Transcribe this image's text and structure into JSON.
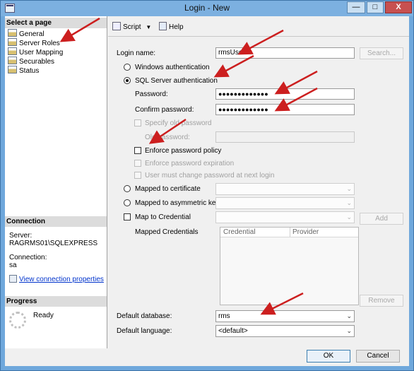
{
  "window": {
    "title": "Login - New",
    "min_label": "—",
    "max_label": "□",
    "close_label": "X"
  },
  "left_panel": {
    "select_page_heading": "Select a page",
    "pages": [
      {
        "label": "General"
      },
      {
        "label": "Server Roles"
      },
      {
        "label": "User Mapping"
      },
      {
        "label": "Securables"
      },
      {
        "label": "Status"
      }
    ],
    "connection_heading": "Connection",
    "server_label": "Server:",
    "server_value": "RAGRMS01\\SQLEXPRESS",
    "connection_label": "Connection:",
    "connection_value": "sa",
    "view_properties_link": "View connection properties",
    "progress_heading": "Progress",
    "progress_status": "Ready"
  },
  "toolbar": {
    "script_label": "Script",
    "help_label": "Help"
  },
  "form": {
    "login_name_label": "Login name:",
    "login_name_value": "rmsUser",
    "search_button": "Search...",
    "windows_auth_label": "Windows authentication",
    "sql_auth_label": "SQL Server authentication",
    "password_label": "Password:",
    "password_value": "●●●●●●●●●●●●●",
    "confirm_password_label": "Confirm password:",
    "confirm_password_value": "●●●●●●●●●●●●●",
    "specify_old_password_label": "Specify old password",
    "old_password_label": "Old password:",
    "enforce_policy_label": "Enforce password policy",
    "enforce_expiration_label": "Enforce password expiration",
    "must_change_label": "User must change password at next login",
    "mapped_cert_label": "Mapped to certificate",
    "mapped_key_label": "Mapped to asymmetric key",
    "map_credential_label": "Map to Credential",
    "add_button": "Add",
    "mapped_credentials_label": "Mapped Credentials",
    "grid_columns": [
      "Credential",
      "Provider"
    ],
    "remove_button": "Remove",
    "default_database_label": "Default database:",
    "default_database_value": "rms",
    "default_language_label": "Default language:",
    "default_language_value": "<default>"
  },
  "buttons": {
    "ok": "OK",
    "cancel": "Cancel"
  },
  "colors": {
    "annotation_arrow": "#cc1f1f",
    "title_bar": "#7cb0e0",
    "link": "#0033cc"
  }
}
